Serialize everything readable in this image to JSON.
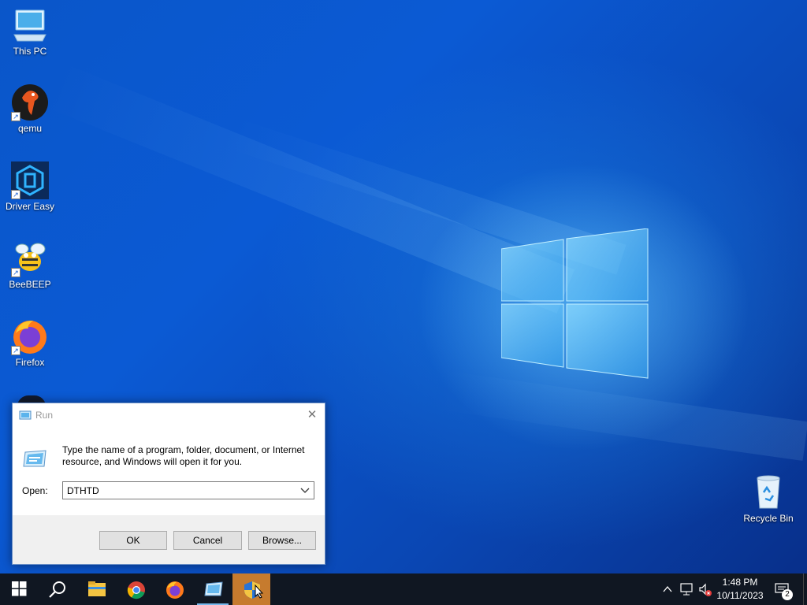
{
  "desktop": {
    "icons": [
      {
        "label": "This PC",
        "icon": "computer-icon"
      },
      {
        "label": "qemu",
        "icon": "qemu-icon"
      },
      {
        "label": "Driver Easy",
        "icon": "driver-easy-icon"
      },
      {
        "label": "BeeBEEP",
        "icon": "bee-icon"
      },
      {
        "label": "Firefox",
        "icon": "firefox-icon"
      },
      {
        "label": "Recycle Bin",
        "icon": "recycle-bin-icon"
      }
    ]
  },
  "run_dialog": {
    "title": "Run",
    "description": "Type the name of a program, folder, document, or Internet resource, and Windows will open it for you.",
    "open_label": "Open:",
    "open_value": "DTHTD",
    "ok_label": "OK",
    "cancel_label": "Cancel",
    "browse_label": "Browse..."
  },
  "taskbar": {
    "items": [
      "start-icon",
      "search-icon",
      "file-explorer-icon",
      "chrome-icon",
      "firefox-icon",
      "run-icon",
      "security-shield-icon"
    ],
    "clock_time": "1:48 PM",
    "clock_date": "10/11/2023",
    "notification_count": "2"
  },
  "colors": {
    "taskbar": "#101722",
    "active_task": "#c67b2e",
    "accent": "#0a56c9"
  }
}
